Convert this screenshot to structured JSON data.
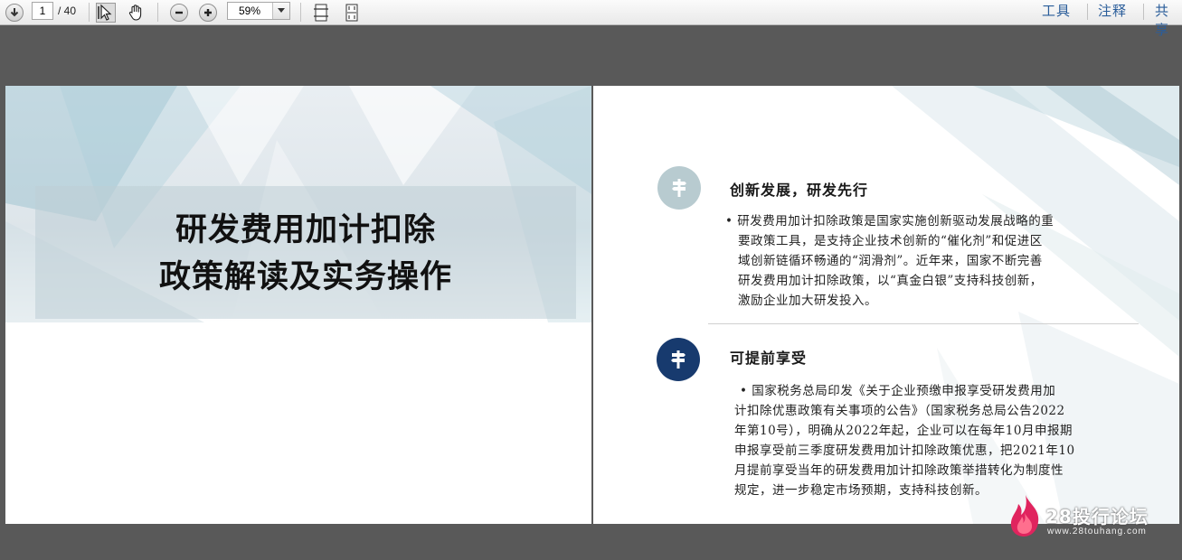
{
  "toolbar": {
    "page_number": "1",
    "page_total": "/ 40",
    "zoom_value": "59%",
    "menu": [
      "工具",
      "注释",
      "共享"
    ]
  },
  "slide_left": {
    "title_line1": "研发费用加计扣除",
    "title_line2": "政策解读及实务操作"
  },
  "slide_right": {
    "section1": {
      "title": "创新发展，研发先行",
      "lines": [
        "• 研发费用加计扣除政策是国家实施创新驱动发展战略的重",
        "要政策工具，是支持企业技术创新的“催化剂”和促进区",
        "域创新链循环畅通的“润滑剂”。近年来，国家不断完善",
        "研发费用加计扣除政策，以“真金白银”支持科技创新，",
        "激励企业加大研发投入。"
      ]
    },
    "section2": {
      "title": "可提前享受",
      "lines": [
        "• 国家税务总局印发《关于企业预缴申报享受研发费用加",
        "计扣除优惠政策有关事项的公告》（国家税务总局公告2022",
        "年第10号），明确从2022年起，企业可以在每年10月申报期",
        "申报享受前三季度研发费用加计扣除政策优惠，把2021年10",
        "月提前享受当年的研发费用加计扣除政策举措转化为制度性",
        "规定，进一步稳定市场预期，支持科技创新。"
      ]
    }
  },
  "watermark": {
    "brand": "28投行论坛",
    "url": "www.28touhang.com"
  },
  "colors": {
    "toolbar_link": "#2a5d9a",
    "icon_light": "#b8cbd0",
    "icon_dark": "#173a6e",
    "viewer_bg": "#595959"
  },
  "icons": [
    "download-icon",
    "select-cursor-icon",
    "hand-icon",
    "zoom-out-icon",
    "zoom-in-icon",
    "chevron-down-icon",
    "fit-page-icon",
    "fit-width-icon",
    "signpost-icon",
    "flame-logo"
  ]
}
